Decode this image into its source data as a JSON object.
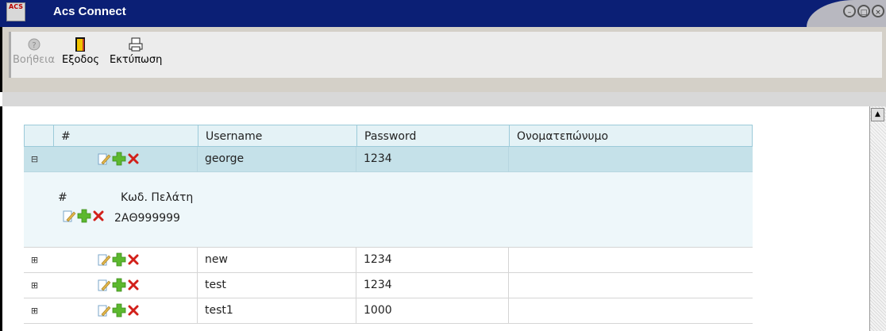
{
  "window": {
    "title": "Acs Connect",
    "app_icon_text": "ACS"
  },
  "toolbar": {
    "help_label": "Βοήθεια",
    "exit_label": "Εξοδος",
    "print_label": "Εκτύπωση"
  },
  "grid": {
    "columns": [
      "#",
      "Username",
      "Password",
      "Ονοματεπώνυμο"
    ],
    "rows": [
      {
        "username": "george",
        "password": "1234",
        "fullname": "",
        "expanded": true
      },
      {
        "username": "new",
        "password": "1234",
        "fullname": "",
        "expanded": false
      },
      {
        "username": "test",
        "password": "1234",
        "fullname": "",
        "expanded": false
      },
      {
        "username": "test1",
        "password": "1000",
        "fullname": "",
        "expanded": false
      }
    ],
    "detail": {
      "columns": [
        "#",
        "Κωδ. Πελάτη"
      ],
      "rows": [
        {
          "customer_code": "2ΑΘ999999"
        }
      ]
    }
  },
  "colors": {
    "titlebar": "#0b1f75",
    "selected_row": "#c5e1e9",
    "header_bg": "#e4f2f6"
  }
}
